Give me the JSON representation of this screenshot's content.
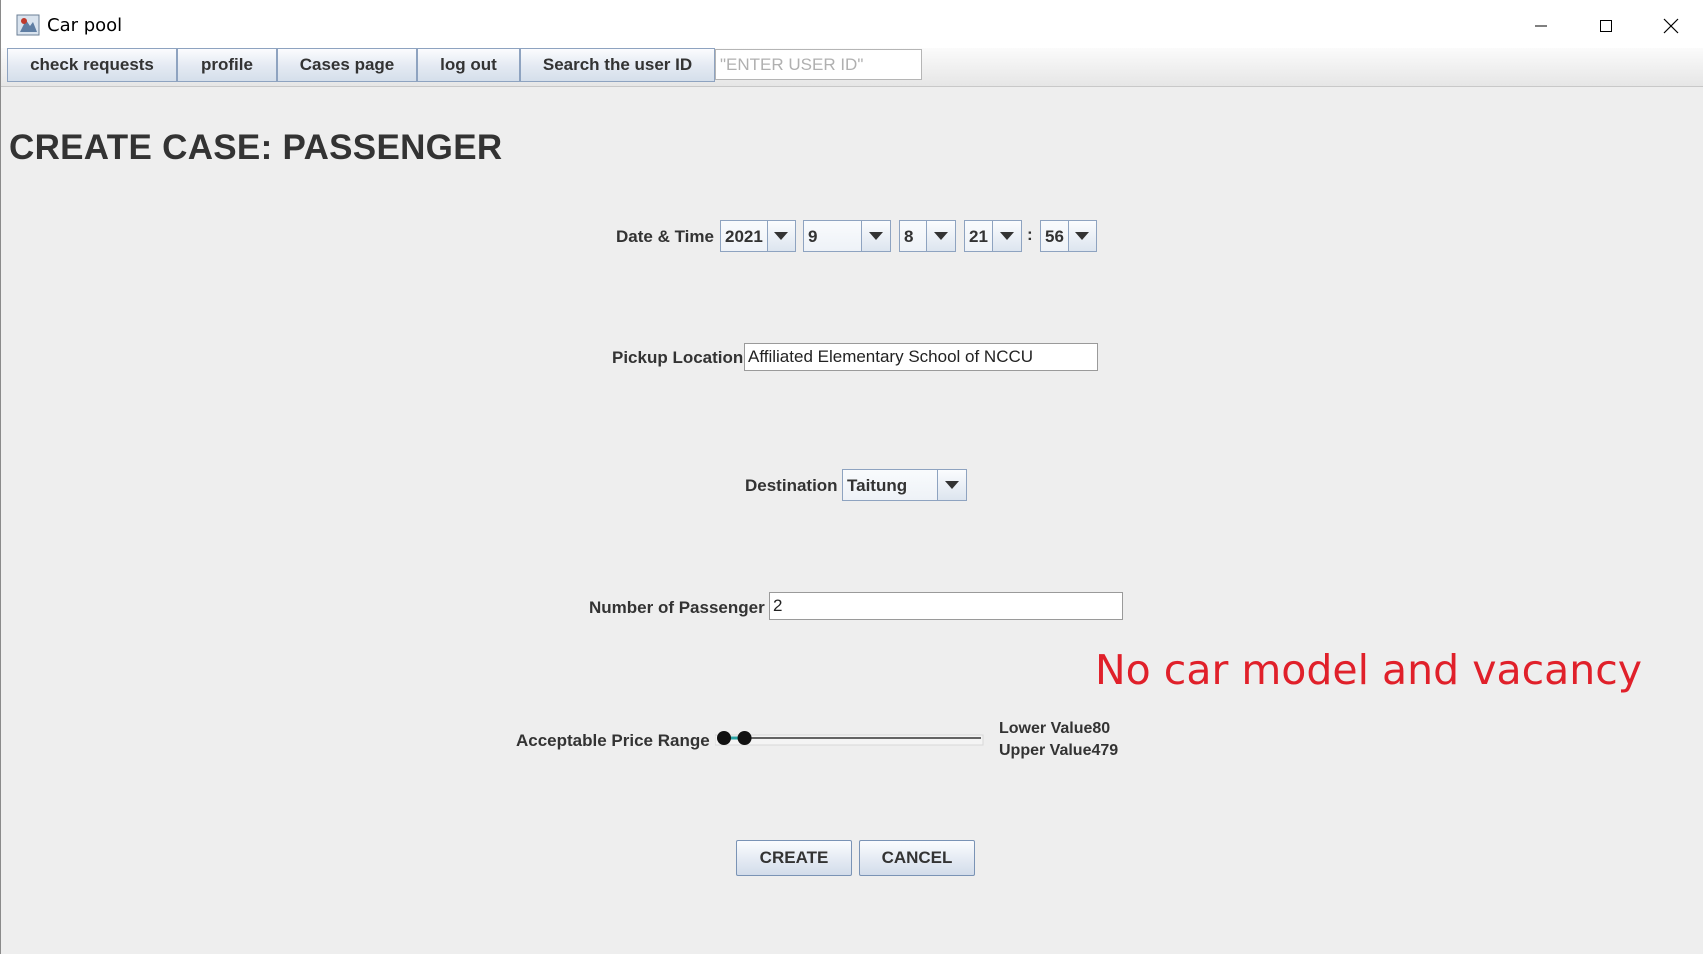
{
  "window": {
    "title": "Car pool"
  },
  "menu": {
    "items": [
      {
        "label": "check requests",
        "name": "check-requests-button"
      },
      {
        "label": "profile",
        "name": "profile-button"
      },
      {
        "label": "Cases page",
        "name": "cases-page-button"
      },
      {
        "label": "log out",
        "name": "log-out-button"
      },
      {
        "label": "Search the user ID",
        "name": "search-user-id-button"
      }
    ],
    "search_placeholder": "\"ENTER USER ID\""
  },
  "page": {
    "title": "CREATE CASE: PASSENGER"
  },
  "form": {
    "datetime": {
      "label": "Date & Time",
      "year": "2021",
      "month": "9",
      "day": "8",
      "hour": "21",
      "separator": ":",
      "minute": "56"
    },
    "pickup": {
      "label": "Pickup Location",
      "value": "Affiliated Elementary School of NCCU"
    },
    "destination": {
      "label": "Destination",
      "value": "Taitung"
    },
    "passengers": {
      "label": "Number of Passenger",
      "value": "2"
    },
    "price": {
      "label": "Acceptable Price Range",
      "lower_text": "Lower Value80",
      "upper_text": "Upper Value479",
      "lower_fraction": 0.0,
      "upper_fraction": 0.08
    }
  },
  "warning": {
    "text": "No car model and vacancy",
    "color": "#e0202a"
  },
  "buttons": {
    "create": "CREATE",
    "cancel": "CANCEL"
  }
}
